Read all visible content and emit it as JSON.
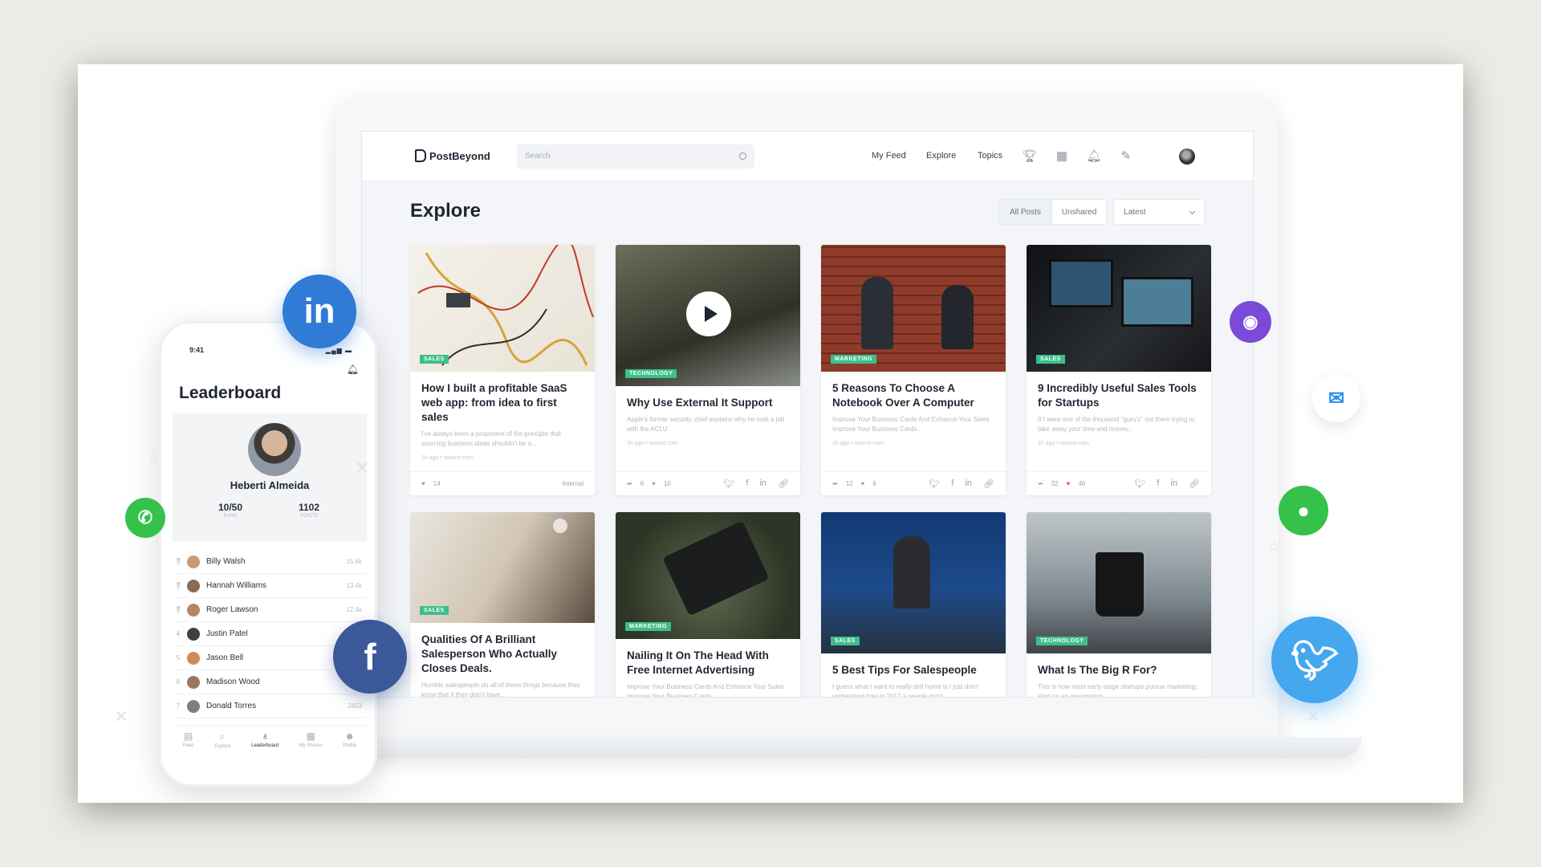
{
  "app": {
    "logo_text": "PostBeyond",
    "search_placeholder": "Search",
    "nav": [
      "My Feed",
      "Explore",
      "Topics"
    ]
  },
  "explore": {
    "title": "Explore",
    "filters": [
      "All Posts",
      "Unshared"
    ],
    "sort_selected": "Latest"
  },
  "cards": [
    {
      "tag": "SALES",
      "title": "How I built a profitable SaaS web app: from idea to first sales",
      "excerpt": "I've always been a proponent of the principle that sourcing business ideas shouldn't be a...",
      "meta": "1h ago • source.com",
      "likes": "14",
      "footer_right": "Internal"
    },
    {
      "tag": "TECHNOLOGY",
      "title": "Why Use External It Support",
      "excerpt": "Apple's former security chief explains why he took a job with the ACLU",
      "meta": "1h ago • source.com",
      "shares": "6",
      "likes": "10"
    },
    {
      "tag": "MARKETING",
      "title": "5 Reasons To Choose A Notebook Over A Computer",
      "excerpt": "Improve Your Business Cards And Enhance Your Sales Improve Your Business Cards...",
      "meta": "1h ago • source.com",
      "shares": "12",
      "likes": "6"
    },
    {
      "tag": "SALES",
      "title": "9 Incredibly Useful Sales Tools for Startups",
      "excerpt": "If I were one of the thousand \"guru's\" out there trying to take away your time and money...",
      "meta": "1h ago • source.com",
      "shares": "32",
      "likes": "46"
    },
    {
      "tag": "SALES",
      "title": "Qualities Of A Brilliant Salesperson Who Actually Closes Deals.",
      "excerpt": "Humble salespeople do all of these things because they know that if they didn't have..."
    },
    {
      "tag": "MARKETING",
      "title": "Nailing It On The Head With Free Internet Advertising",
      "excerpt": "Improve Your Business Cards And Enhance Your Sales Improve Your Business Cards"
    },
    {
      "tag": "SALES",
      "title": "5 Best Tips For Salespeople",
      "excerpt": "I guess what I want to really drill home is I just don't understand how in 2017 a people don't..."
    },
    {
      "tag": "TECHNOLOGY",
      "title": "What Is The Big R For?",
      "excerpt": "This is how most early-stage startups pursue marketing: start on an assumption..."
    }
  ],
  "phone": {
    "time": "9:41",
    "title": "Leaderboard",
    "user_name": "Heberti Almeida",
    "rank_value": "10/50",
    "rank_label": "RANK",
    "points_value": "1102",
    "points_label": "POINTS",
    "leaders": [
      {
        "rank": "1",
        "name": "Billy Walsh",
        "points": "15.6k"
      },
      {
        "rank": "2",
        "name": "Hannah Williams",
        "points": "13.4k"
      },
      {
        "rank": "3",
        "name": "Roger Lawson",
        "points": "12.4k"
      },
      {
        "rank": "4",
        "name": "Justin Patel",
        "points": ""
      },
      {
        "rank": "5",
        "name": "Jason Bell",
        "points": ""
      },
      {
        "rank": "6",
        "name": "Madison Wood",
        "points": ""
      },
      {
        "rank": "7",
        "name": "Donald Torres",
        "points": "2453"
      }
    ],
    "tabs": [
      "Feed",
      "Explore",
      "Leaderboard",
      "My Shares",
      "Profile"
    ]
  },
  "social": {
    "linkedin": "in",
    "facebook": "f"
  },
  "colors": {
    "linkedin": "#2f7bd6",
    "facebook": "#3b5998",
    "twitter": "#45a7ee",
    "whatsapp": "#35c24a",
    "instagram": "#7b4ad8",
    "messenger": "#2c8ff0",
    "tag_green": "#3dbf8a"
  }
}
